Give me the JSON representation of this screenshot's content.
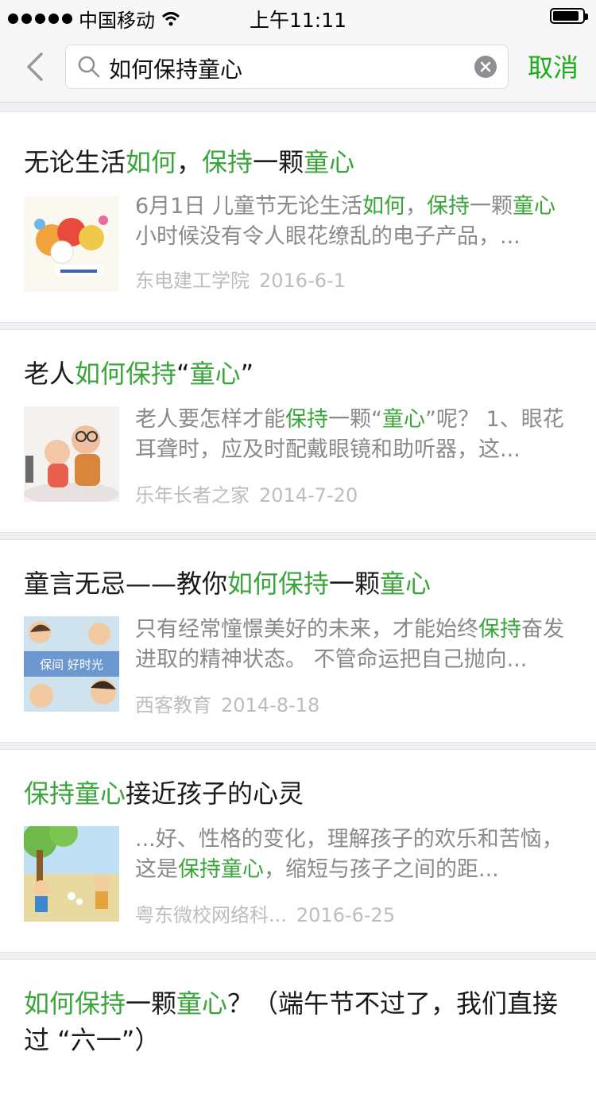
{
  "status_bar": {
    "carrier": "中国移动",
    "time": "上午11:11"
  },
  "search": {
    "query": "如何保持童心",
    "cancel_label": "取消"
  },
  "colors": {
    "accent": "#1aad19",
    "highlight": "#3aa53a",
    "snippet": "#8a8a8a",
    "meta": "#bdbdbd"
  },
  "results": [
    {
      "title": [
        [
          "无论生活",
          false
        ],
        [
          "如何",
          true
        ],
        [
          "，",
          false
        ],
        [
          "保持",
          true
        ],
        [
          "一颗",
          false
        ],
        [
          "童心",
          true
        ]
      ],
      "snippet": [
        [
          "6月1日 儿童节无论生活",
          false
        ],
        [
          "如何",
          true
        ],
        [
          "，",
          false
        ],
        [
          "保持",
          true
        ],
        [
          "一颗",
          false
        ],
        [
          "童心",
          true
        ],
        [
          "小时候没有令人眼花缭乱的电子产品，...",
          false
        ]
      ],
      "source": "东电建工学院",
      "date": "2016-6-1",
      "thumb_icon": "childrens-day-cartoon-image"
    },
    {
      "title": [
        [
          "老人",
          false
        ],
        [
          "如何保持",
          true
        ],
        [
          "“",
          false
        ],
        [
          "童心",
          true
        ],
        [
          "”",
          false
        ]
      ],
      "snippet": [
        [
          "老人要怎样才能",
          false
        ],
        [
          "保持",
          true
        ],
        [
          "一颗“",
          false
        ],
        [
          "童心",
          true
        ],
        [
          "”呢？ 1、眼花耳聋时，应及时配戴眼镜和助听器，这...",
          false
        ]
      ],
      "source": "乐年长者之家",
      "date": "2014-7-20",
      "thumb_icon": "elderly-couple-figurine-image"
    },
    {
      "title": [
        [
          "童言无忌——教你",
          false
        ],
        [
          "如何保持",
          true
        ],
        [
          "一颗",
          false
        ],
        [
          "童心",
          true
        ]
      ],
      "snippet": [
        [
          "只有经常憧憬美好的未来，才能始终",
          false
        ],
        [
          "保持",
          true
        ],
        [
          "奋发进取的精神状态。 不管命运把自己抛向...",
          false
        ]
      ],
      "source": "西客教育",
      "date": "2014-8-18",
      "thumb_icon": "school-days-cartoon-image",
      "thumb_text": "保间 好时光"
    },
    {
      "title": [
        [
          "保持童心",
          true
        ],
        [
          "接近孩子的心灵",
          false
        ]
      ],
      "snippet": [
        [
          "...好、性格的变化，理解孩子的欢乐和苦恼，这是",
          false
        ],
        [
          "保持童心",
          true
        ],
        [
          "，缩短与孩子之间的距...",
          false
        ]
      ],
      "source": "粤东微校网络科...",
      "date": "2016-6-25",
      "thumb_icon": "kids-playing-cartoon-image"
    },
    {
      "title": [
        [
          "如何保持",
          true
        ],
        [
          "一颗",
          false
        ],
        [
          "童心",
          true
        ],
        [
          "？（端午节不过了，我们直接过 “六一”）",
          false
        ]
      ],
      "snippet": [],
      "source": "",
      "date": "",
      "thumb_icon": ""
    }
  ]
}
